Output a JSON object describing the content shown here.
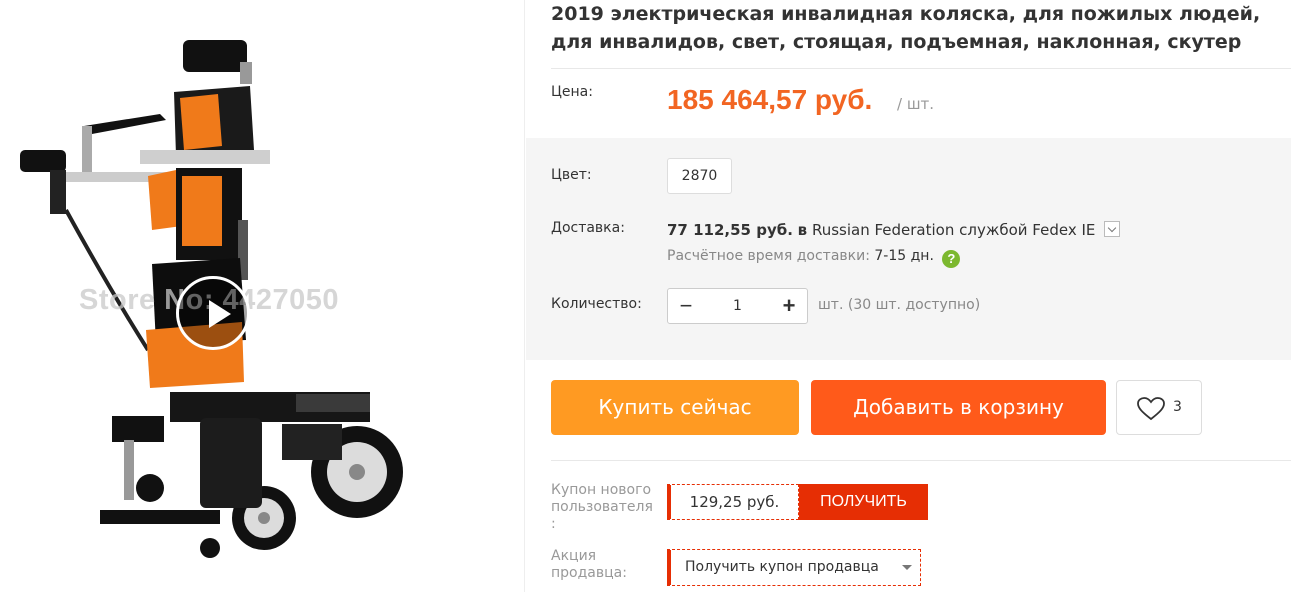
{
  "gallery": {
    "watermark": "Store No: 4427050"
  },
  "product": {
    "title": "2019 электрическая инвалидная коляска, для пожилых людей, для инвалидов, свет, стоящая, подъемная, наклонная, скутер",
    "price_label": "Цена:",
    "price": "185 464,57 руб.",
    "per_unit": "/ шт.",
    "price_color": "#f26522"
  },
  "options": {
    "color_label": "Цвет:",
    "color_value": "2870"
  },
  "shipping": {
    "label": "Доставка:",
    "cost": "77 112,55 руб.",
    "in_word": "в",
    "destination": "Russian Federation",
    "service": "службой Fedex IE",
    "time_label": "Расчётное время доставки:",
    "time_value": "7-15  дн."
  },
  "quantity": {
    "label": "Количество:",
    "minus": "−",
    "value": "1",
    "plus": "+",
    "available": "шт. (30 шт. доступно)"
  },
  "actions": {
    "buy_now": "Купить сейчас",
    "add_to_cart": "Добавить в корзину",
    "wishlist_count": "3",
    "buy_color": "#ff9a22",
    "cart_color": "#ff5a1a"
  },
  "coupon": {
    "label_line1": "Купон нового",
    "label_line2": "пользователя",
    "label_line3": ":",
    "amount": "129,25 руб.",
    "get_label": "ПОЛУЧИТЬ",
    "accent_color": "#e62e04"
  },
  "promo": {
    "label_line1": "Акция",
    "label_line2": "продавца:",
    "select_value": "Получить купон продавца"
  }
}
